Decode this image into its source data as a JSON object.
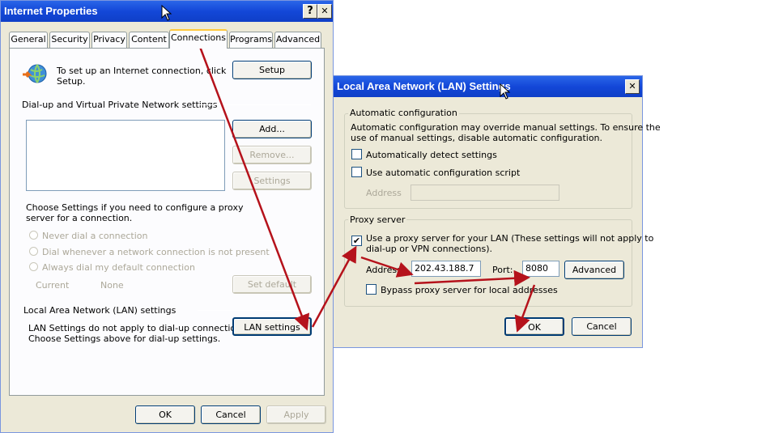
{
  "internet_properties": {
    "title": "Internet Properties",
    "help_btn": "?",
    "close_btn": "✕",
    "tabs": [
      "General",
      "Security",
      "Privacy",
      "Content",
      "Connections",
      "Programs",
      "Advanced"
    ],
    "setup_text": "To set up an Internet connection, click Setup.",
    "setup_line1": "To set up an Internet connection, click",
    "setup_line2": "Setup.",
    "setup_btn": "Setup",
    "dialup_header": "Dial-up and Virtual Private Network settings",
    "add_btn": "Add...",
    "remove_btn": "Remove...",
    "settings_btn": "Settings",
    "choose_line1": "Choose Settings if you need to configure a proxy",
    "choose_line2": "server for a connection.",
    "radio_never": "Never dial a connection",
    "radio_whenever": "Dial whenever a network connection is not present",
    "radio_always": "Always dial my default connection",
    "current_label": "Current",
    "current_value": "None",
    "set_default_btn": "Set default",
    "lan_header": "Local Area Network (LAN) settings",
    "lan_line1": "LAN Settings do not apply to dial-up connections.",
    "lan_line2": "Choose Settings above for dial-up settings.",
    "lan_btn": "LAN settings",
    "ok_btn": "OK",
    "cancel_btn": "Cancel",
    "apply_btn": "Apply"
  },
  "lan_dialog": {
    "title": "Local Area Network (LAN) Settings",
    "close_btn": "✕",
    "auto_group": "Automatic configuration",
    "auto_line1": "Automatic configuration may override manual settings.  To ensure the",
    "auto_line2": "use of manual settings, disable automatic configuration.",
    "auto_detect": "Automatically detect settings",
    "auto_detect_checked": false,
    "auto_script": "Use automatic configuration script",
    "auto_script_checked": false,
    "address_label": "Address",
    "address_value": "",
    "proxy_group": "Proxy server",
    "use_proxy_line1": "Use a proxy server for your LAN (These settings will not apply to",
    "use_proxy_line2": "dial-up or VPN connections).",
    "use_proxy_checked": true,
    "proxy_address_label": "Address:",
    "proxy_address_value": "202.43.188.7",
    "port_label": "Port:",
    "port_value": "8080",
    "advanced_btn": "Advanced",
    "bypass_label": "Bypass proxy server for local addresses",
    "bypass_checked": false,
    "ok_btn": "OK",
    "cancel_btn": "Cancel"
  },
  "colors": {
    "title_bar": "#1347d8",
    "dialog_bg": "#ece9d8",
    "annotation_arrow": "#b5121b"
  },
  "icons": [
    "globe-network-icon",
    "mouse-cursor-icon",
    "checkmark-icon",
    "close-icon",
    "help-icon"
  ]
}
